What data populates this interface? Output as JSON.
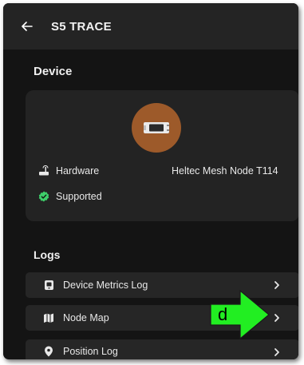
{
  "appbar": {
    "title": "S5 TRACE",
    "back_icon": "arrow-left-icon"
  },
  "device_section": {
    "title": "Device",
    "hardware_label": "Hardware",
    "hardware_value": "Heltec Mesh Node T114",
    "supported_label": "Supported",
    "avatar_color": "#9d5a2a",
    "supported_color": "#3ecf6a"
  },
  "logs_section": {
    "title": "Logs",
    "items": [
      {
        "label": "Device Metrics Log",
        "icon": "device-metrics-icon"
      },
      {
        "label": "Node Map",
        "icon": "map-icon"
      },
      {
        "label": "Position Log",
        "icon": "location-pin-icon"
      }
    ]
  },
  "annotation": {
    "label": "d",
    "color": "#22ee22"
  },
  "colors": {
    "background": "#141414",
    "appbar": "#242424",
    "card": "#232323"
  }
}
